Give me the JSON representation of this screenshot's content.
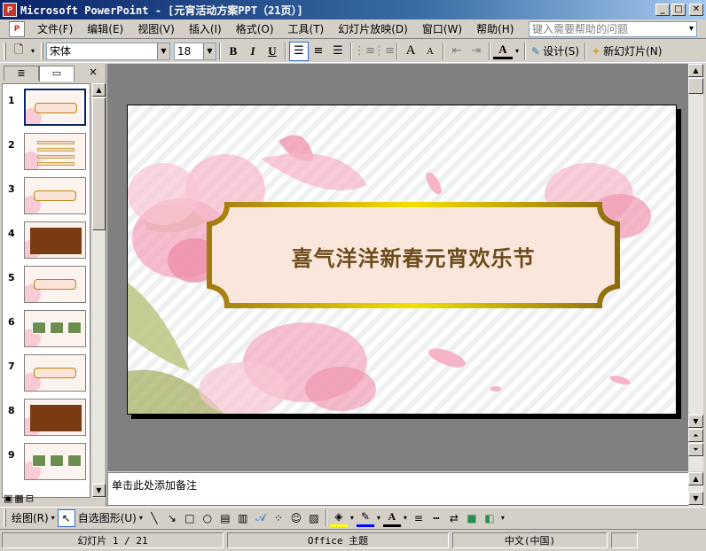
{
  "window": {
    "title": "Microsoft PowerPoint - [元宵活动方案PPT（21页）]",
    "app_icon": "powerpoint-icon",
    "controls": [
      "minimize",
      "maximize",
      "close"
    ]
  },
  "menubar": {
    "items": [
      "文件(F)",
      "编辑(E)",
      "视图(V)",
      "插入(I)",
      "格式(O)",
      "工具(T)",
      "幻灯片放映(D)",
      "窗口(W)",
      "帮助(H)"
    ],
    "help_placeholder": "键入需要帮助的问题"
  },
  "toolbar": {
    "font_name": "宋体",
    "font_size": "18",
    "bold": "B",
    "italic": "I",
    "underline": "U",
    "grow_font": "A",
    "shrink_font": "A",
    "font_color_label": "A",
    "design_label": "设计(S)",
    "new_slide_label": "新幻灯片(N)",
    "alignment_selected": "left"
  },
  "left_pane": {
    "tabs": [
      "大纲",
      "幻灯片"
    ],
    "active_tab": 1,
    "close": "×",
    "thumbnails": [
      {
        "num": "1",
        "style": "title",
        "selected": true
      },
      {
        "num": "2",
        "style": "lines",
        "selected": false
      },
      {
        "num": "3",
        "style": "band",
        "selected": false
      },
      {
        "num": "4",
        "style": "dark",
        "selected": false
      },
      {
        "num": "5",
        "style": "band",
        "selected": false
      },
      {
        "num": "6",
        "style": "photos",
        "selected": false
      },
      {
        "num": "7",
        "style": "band",
        "selected": false
      },
      {
        "num": "8",
        "style": "dark",
        "selected": false
      },
      {
        "num": "9",
        "style": "photos",
        "selected": false
      }
    ]
  },
  "slide": {
    "title": "喜气洋洋新春元宵欢乐节",
    "colors": {
      "title_text": "#6b4b1c",
      "frame_gold": "#d4a017",
      "frame_fill": "#fbe6dc",
      "flower_pink": "#f4a7bd"
    }
  },
  "notes": {
    "placeholder": "单击此处添加备注"
  },
  "drawbar": {
    "draw_label": "绘图(R)",
    "autoshape_label": "自选图形(U)"
  },
  "status": {
    "slide_indicator": "幻灯片 1 / 21",
    "theme": "Office 主题",
    "language": "中文(中国)"
  }
}
